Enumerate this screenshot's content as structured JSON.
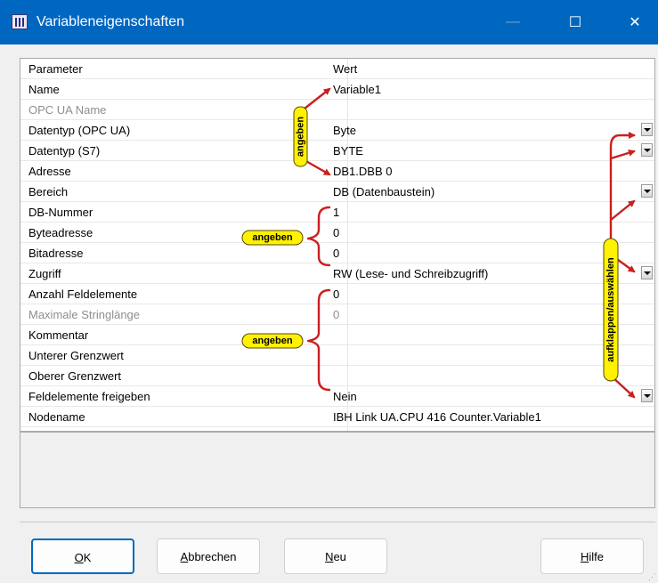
{
  "window": {
    "title": "Variableneigenschaften",
    "minimize_glyph": "—",
    "maximize_glyph": "☐",
    "close_glyph": "✕"
  },
  "grid": {
    "header": {
      "param": "Parameter",
      "value": "Wert"
    },
    "rows": [
      {
        "name": "Name",
        "value": "Variable1",
        "dropdown": false,
        "disabled": false
      },
      {
        "name": "OPC UA Name",
        "value": "",
        "dropdown": false,
        "disabled": true
      },
      {
        "name": "Datentyp (OPC UA)",
        "value": "Byte",
        "dropdown": true,
        "disabled": false
      },
      {
        "name": "Datentyp (S7)",
        "value": "BYTE",
        "dropdown": true,
        "disabled": false
      },
      {
        "name": "Adresse",
        "value": "DB1.DBB 0",
        "dropdown": false,
        "disabled": false
      },
      {
        "name": "Bereich",
        "value": "DB (Datenbaustein)",
        "dropdown": true,
        "disabled": false
      },
      {
        "name": "DB-Nummer",
        "value": "1",
        "dropdown": false,
        "disabled": false
      },
      {
        "name": "Byteadresse",
        "value": "0",
        "dropdown": false,
        "disabled": false
      },
      {
        "name": "Bitadresse",
        "value": "0",
        "dropdown": false,
        "disabled": false
      },
      {
        "name": "Zugriff",
        "value": "RW (Lese- und Schreibzugriff)",
        "dropdown": true,
        "disabled": false
      },
      {
        "name": "Anzahl Feldelemente",
        "value": "0",
        "dropdown": false,
        "disabled": false
      },
      {
        "name": "Maximale Stringlänge",
        "value": "0",
        "dropdown": false,
        "disabled": true
      },
      {
        "name": "Kommentar",
        "value": "",
        "dropdown": false,
        "disabled": false
      },
      {
        "name": "Unterer Grenzwert",
        "value": "",
        "dropdown": false,
        "disabled": false
      },
      {
        "name": "Oberer Grenzwert",
        "value": "",
        "dropdown": false,
        "disabled": false
      },
      {
        "name": "Feldelemente freigeben",
        "value": "Nein",
        "dropdown": true,
        "disabled": false
      },
      {
        "name": "Nodename",
        "value": "IBH Link UA.CPU 416 Counter.Variable1",
        "dropdown": false,
        "disabled": false
      }
    ]
  },
  "annotations": {
    "angeben_vertical": "angeben",
    "angeben_byte": "angeben",
    "angeben_kommentar": "angeben",
    "aufklappen": "aufklappen/auswählen",
    "label_bg": "#fff200",
    "arrow_color": "#cc1f1f"
  },
  "buttons": {
    "ok": "OK",
    "cancel": "Abbrechen",
    "new": "Neu",
    "help": "Hilfe"
  }
}
